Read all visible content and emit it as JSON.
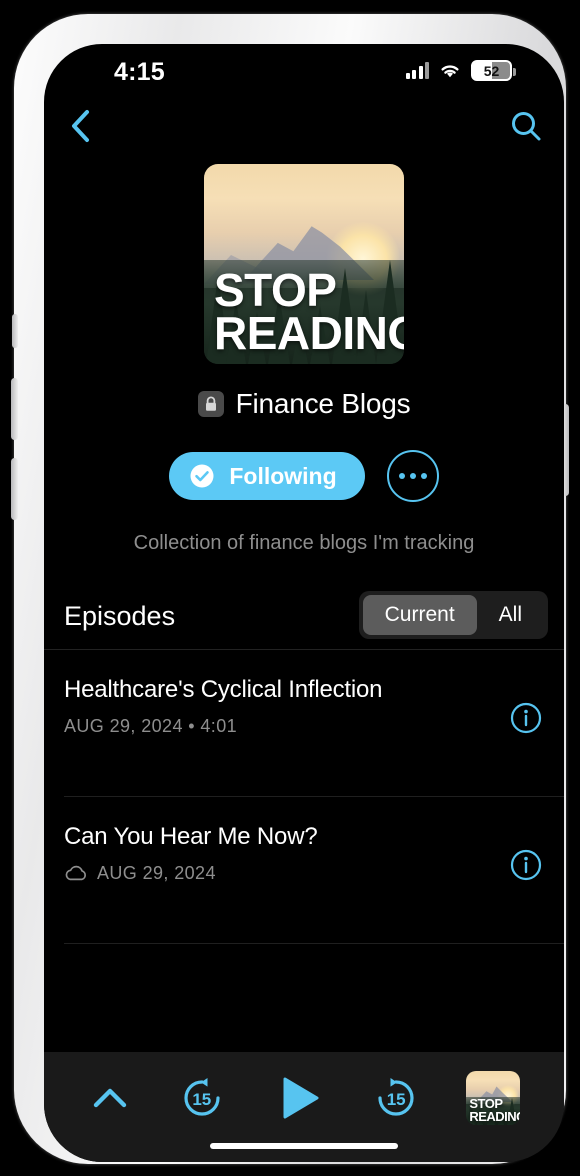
{
  "status_bar": {
    "time": "4:15",
    "signal_icon": "cellular-signal-icon",
    "wifi_icon": "wifi-icon",
    "battery_percent": "52"
  },
  "nav": {
    "back_icon": "chevron-left-icon",
    "search_icon": "search-icon"
  },
  "show": {
    "artwork_title_line1": "STOP",
    "artwork_title_line2": "READING!",
    "lock_icon": "lock-icon",
    "title": "Finance Blogs",
    "description": "Collection of finance blogs I'm tracking"
  },
  "actions": {
    "following_label": "Following",
    "following_icon": "check-circle-icon",
    "following_color": "#5cc9f5",
    "more_icon": "ellipsis-icon"
  },
  "episodes_section": {
    "heading": "Episodes",
    "segments": [
      {
        "label": "Current",
        "selected": true
      },
      {
        "label": "All",
        "selected": false
      }
    ]
  },
  "episodes": [
    {
      "title": "Healthcare's Cyclical Inflection",
      "meta": "AUG 29, 2024 • 4:01",
      "has_cloud_icon": false,
      "info_icon": "info-circle-icon"
    },
    {
      "title": "Can You Hear Me Now?",
      "meta": "AUG 29, 2024",
      "has_cloud_icon": true,
      "cloud_icon": "cloud-download-icon",
      "info_icon": "info-circle-icon"
    }
  ],
  "player": {
    "expand_icon": "chevron-up-icon",
    "rewind_label": "15",
    "rewind_icon": "rewind-15-icon",
    "play_icon": "play-icon",
    "forward_label": "15",
    "forward_icon": "forward-15-icon",
    "artwork_icon": "now-playing-artwork",
    "accent_color": "#57c4f0"
  }
}
